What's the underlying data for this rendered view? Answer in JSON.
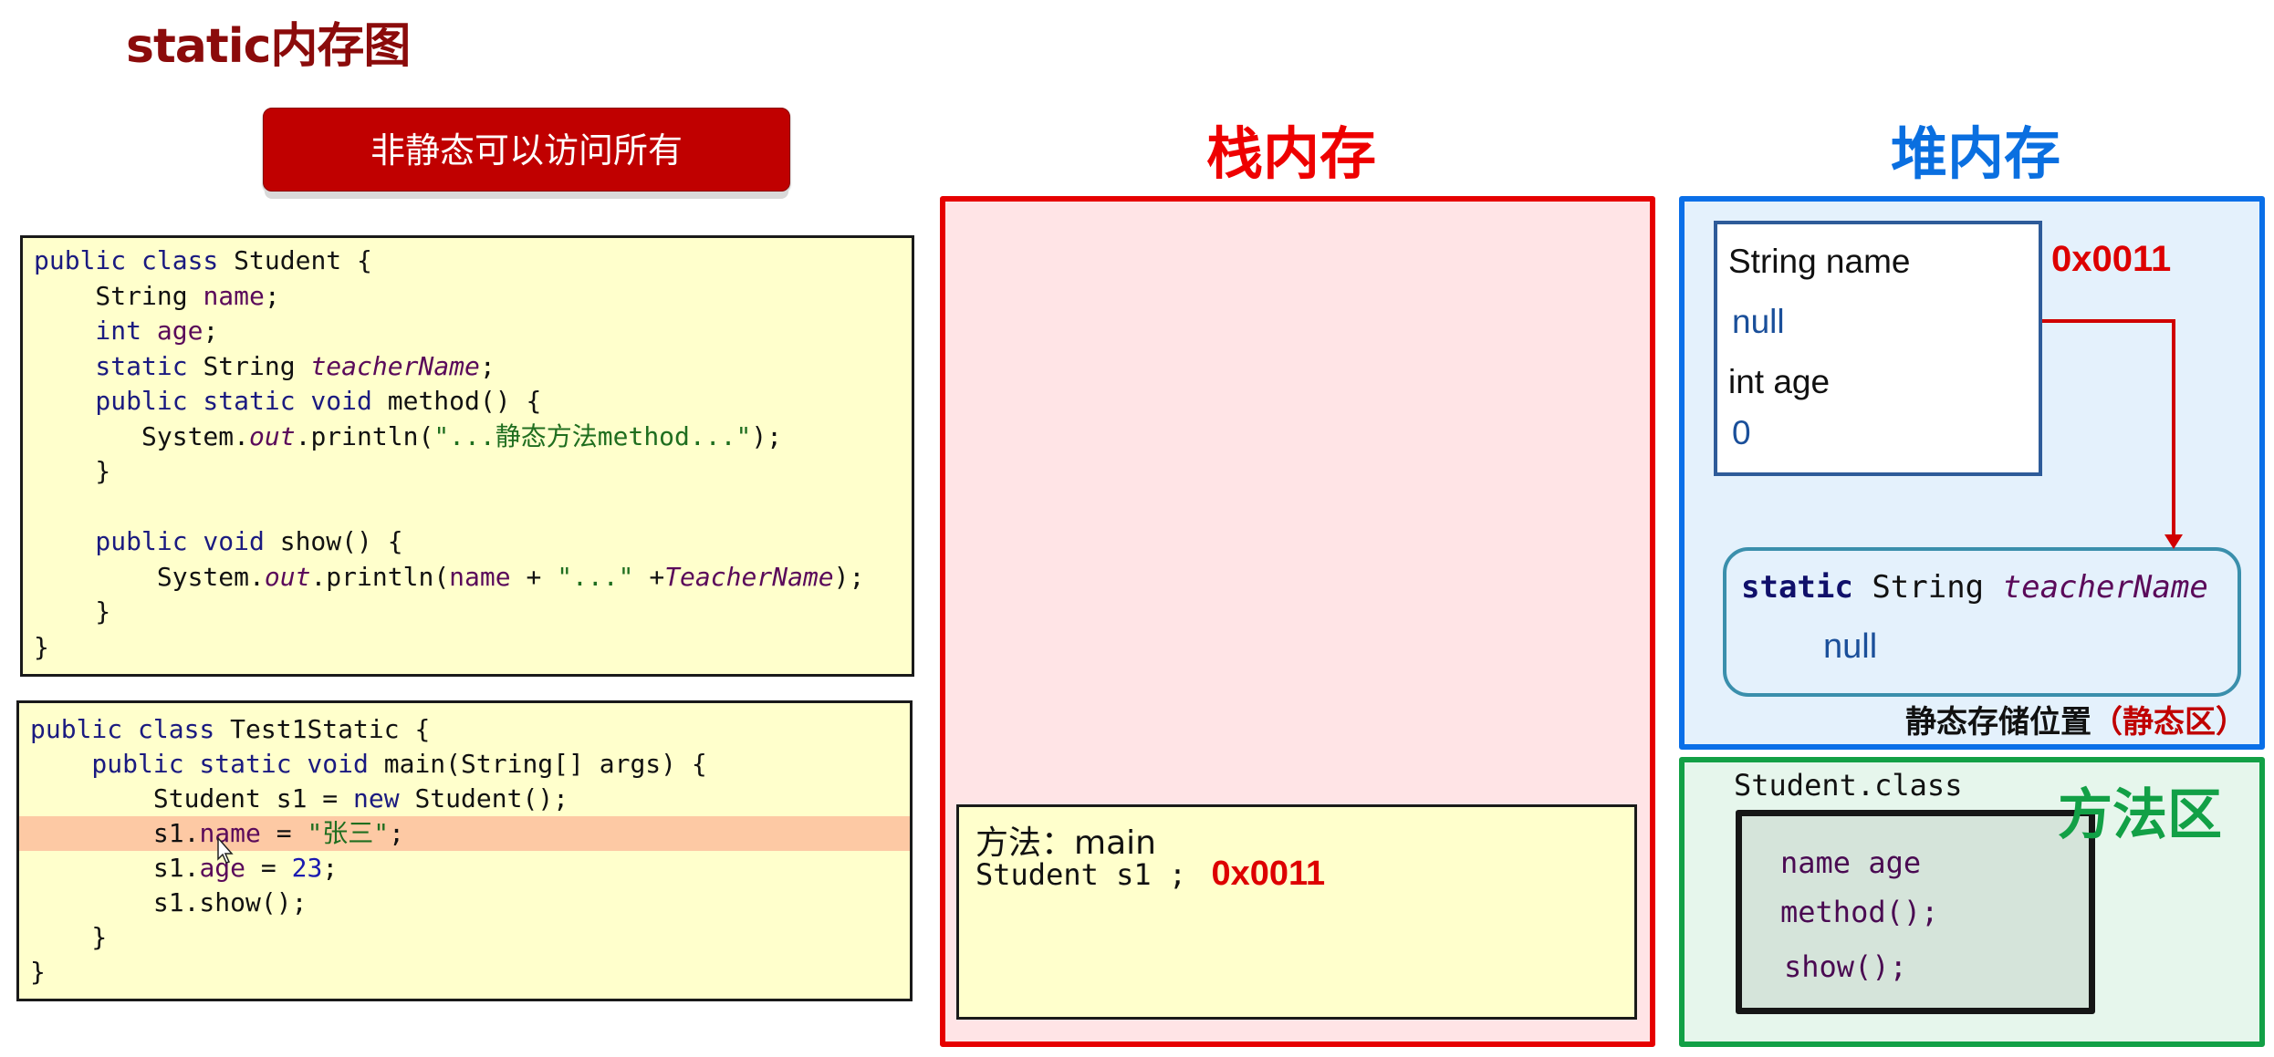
{
  "page": {
    "title": "static内存图",
    "tip_button": "非静态可以访问所有"
  },
  "code_student": {
    "lines": [
      [
        {
          "t": "public class ",
          "c": "kw"
        },
        {
          "t": "Student {",
          "c": ""
        }
      ],
      [
        {
          "t": "    String ",
          "c": ""
        },
        {
          "t": "name",
          "c": "fld"
        },
        {
          "t": ";",
          "c": ""
        }
      ],
      [
        {
          "t": "    int ",
          "c": "kw"
        },
        {
          "t": "age",
          "c": "fld"
        },
        {
          "t": ";",
          "c": ""
        }
      ],
      [
        {
          "t": "    static ",
          "c": "kw"
        },
        {
          "t": "String ",
          "c": ""
        },
        {
          "t": "teacherName",
          "c": "ital"
        },
        {
          "t": ";",
          "c": ""
        }
      ],
      [
        {
          "t": "    public static void ",
          "c": "kw"
        },
        {
          "t": "method() {",
          "c": ""
        }
      ],
      [
        {
          "t": "       System.",
          "c": ""
        },
        {
          "t": "out",
          "c": "ital"
        },
        {
          "t": ".println(",
          "c": ""
        },
        {
          "t": "\"...静态方法method...\"",
          "c": "str"
        },
        {
          "t": ");",
          "c": ""
        }
      ],
      [
        {
          "t": "    }",
          "c": ""
        }
      ],
      [
        {
          "t": "",
          "c": ""
        }
      ],
      [
        {
          "t": "    public void ",
          "c": "kw"
        },
        {
          "t": "show() {",
          "c": ""
        }
      ],
      [
        {
          "t": "        System.",
          "c": ""
        },
        {
          "t": "out",
          "c": "ital"
        },
        {
          "t": ".println(",
          "c": ""
        },
        {
          "t": "name",
          "c": "fld"
        },
        {
          "t": " + ",
          "c": ""
        },
        {
          "t": "\"...\"",
          "c": "str"
        },
        {
          "t": " +",
          "c": ""
        },
        {
          "t": "TeacherName",
          "c": "ital"
        },
        {
          "t": ");",
          "c": ""
        }
      ],
      [
        {
          "t": "    }",
          "c": ""
        }
      ],
      [
        {
          "t": "}",
          "c": ""
        }
      ]
    ]
  },
  "code_test": {
    "highlight_line": 3,
    "lines": [
      [
        {
          "t": "public class ",
          "c": "kw"
        },
        {
          "t": "Test1Static {",
          "c": ""
        }
      ],
      [
        {
          "t": "    public static void ",
          "c": "kw"
        },
        {
          "t": "main(String[] args) {",
          "c": ""
        }
      ],
      [
        {
          "t": "        Student s1 = ",
          "c": ""
        },
        {
          "t": "new ",
          "c": "kw"
        },
        {
          "t": "Student();",
          "c": ""
        }
      ],
      [
        {
          "t": "        s1.",
          "c": ""
        },
        {
          "t": "name",
          "c": "fld"
        },
        {
          "t": " = ",
          "c": ""
        },
        {
          "t": "\"张三\"",
          "c": "str"
        },
        {
          "t": ";",
          "c": ""
        }
      ],
      [
        {
          "t": "        s1.",
          "c": ""
        },
        {
          "t": "age",
          "c": "fld"
        },
        {
          "t": " = ",
          "c": ""
        },
        {
          "t": "23",
          "c": "num"
        },
        {
          "t": ";",
          "c": ""
        }
      ],
      [
        {
          "t": "        s1.show();",
          "c": ""
        }
      ],
      [
        {
          "t": "    }",
          "c": ""
        }
      ],
      [
        {
          "t": "}",
          "c": ""
        }
      ]
    ]
  },
  "stack": {
    "title": "栈内存",
    "frame": {
      "method_label": "方法：main",
      "var_decl": "Student s1 ;",
      "var_value": "0x0011"
    }
  },
  "heap": {
    "title": "堆内存",
    "object": {
      "address": "0x0011",
      "fields": [
        {
          "label": "String name",
          "value": "null"
        },
        {
          "label": "int age",
          "value": "0"
        }
      ]
    },
    "static_area": {
      "keyword": "static",
      "type": "String",
      "name": "teacherName",
      "value": "null",
      "label": "静态存储位置",
      "label_paren": "（静态区）"
    }
  },
  "method_area": {
    "title": "方法区",
    "class_file": "Student.class",
    "members": [
      "name age",
      "method();",
      "show();"
    ]
  },
  "colors": {
    "stack_border": "#e60000",
    "heap_border": "#0a6fe8",
    "method_area_border": "#12a046",
    "address_red": "#dd0000",
    "tip_button_bg": "#c00000"
  }
}
